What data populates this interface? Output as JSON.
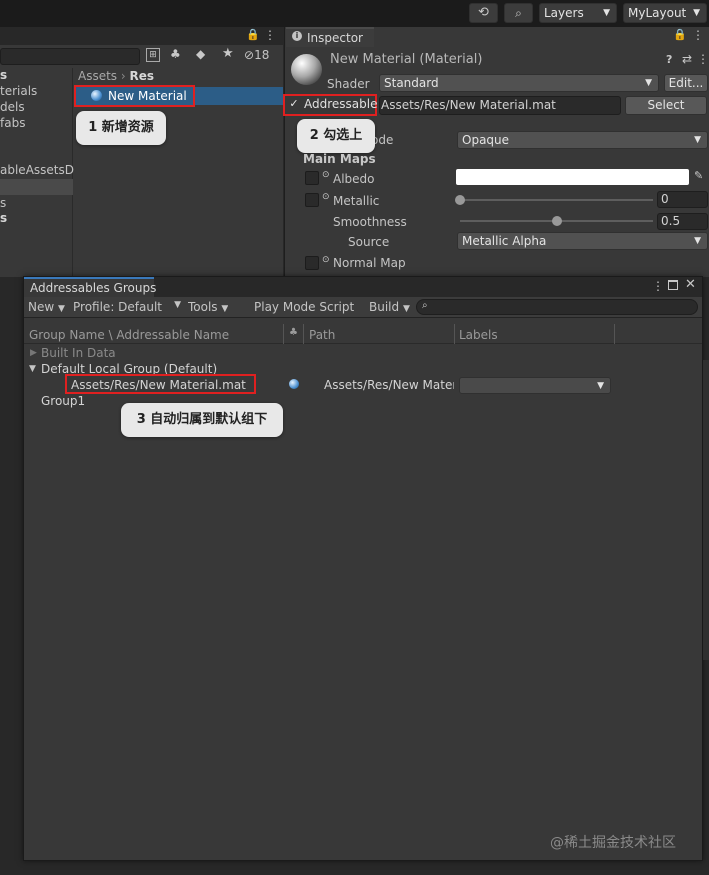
{
  "toolbar": {
    "layers_label": "Layers",
    "layout_label": "MyLayout"
  },
  "project": {
    "tree_items": [
      "s",
      "terials",
      "dels",
      "fabs",
      "ableAssetsD",
      "s",
      "s"
    ],
    "breadcrumb_root": "Assets",
    "breadcrumb_sep": "›",
    "breadcrumb_current": "Res",
    "asset_name": "New Material",
    "hidden_count": "18"
  },
  "inspector": {
    "tab_label": "Inspector",
    "title": "New Material (Material)",
    "shader_label": "Shader",
    "shader_value": "Standard",
    "edit_label": "Edit...",
    "addressable_label": "Addressable",
    "address_value": "Assets/Res/New Material.mat",
    "select_label": "Select",
    "render_mode_partial": "ode",
    "render_mode_value": "Opaque",
    "main_maps_label": "Main Maps",
    "albedo_label": "Albedo",
    "metallic_label": "Metallic",
    "metallic_value": "0",
    "metallic_level": 0.0,
    "smoothness_label": "Smoothness",
    "smoothness_value": "0.5",
    "smoothness_level": 0.5,
    "source_label": "Source",
    "source_value": "Metallic Alpha",
    "normal_map_label": "Normal Map"
  },
  "groups": {
    "tab_label": "Addressables Groups",
    "menu_new": "New",
    "menu_profile": "Profile: Default",
    "menu_tools": "Tools",
    "menu_play_mode": "Play Mode Script",
    "menu_build": "Build",
    "col_name": "Group Name \\ Addressable Name",
    "col_path": "Path",
    "col_labels": "Labels",
    "rows": {
      "built_in": "Built In Data",
      "default_group": "Default Local Group (Default)",
      "entry_name": "Assets/Res/New Material.mat",
      "entry_path": "Assets/Res/New Mater",
      "group1": "Group1"
    }
  },
  "callouts": {
    "step1": "1 新增资源",
    "step2": "2 勾选上",
    "step3": "3 自动归属到默认组下"
  },
  "watermark": "@稀土掘金技术社区",
  "colors": {
    "highlight_red": "#e02020",
    "selection_blue": "#2c5d87",
    "panel_bg": "#383838"
  }
}
